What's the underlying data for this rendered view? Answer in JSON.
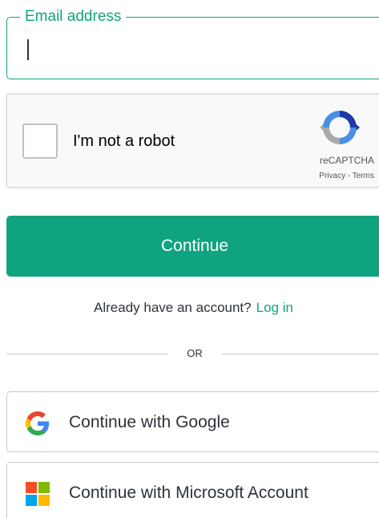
{
  "email": {
    "label": "Email address",
    "value": ""
  },
  "captcha": {
    "label": "I'm not a robot",
    "brand": "reCAPTCHA",
    "links": "Privacy - Terms"
  },
  "continue_button": {
    "label": "Continue"
  },
  "login": {
    "prompt": "Already have an account?",
    "link": "Log in"
  },
  "divider": {
    "text": "OR"
  },
  "social": {
    "google_label": "Continue with Google",
    "microsoft_label": "Continue with Microsoft Account"
  },
  "colors": {
    "accent": "#10a37f",
    "text": "#2d333a",
    "border": "#c2c8d0"
  }
}
